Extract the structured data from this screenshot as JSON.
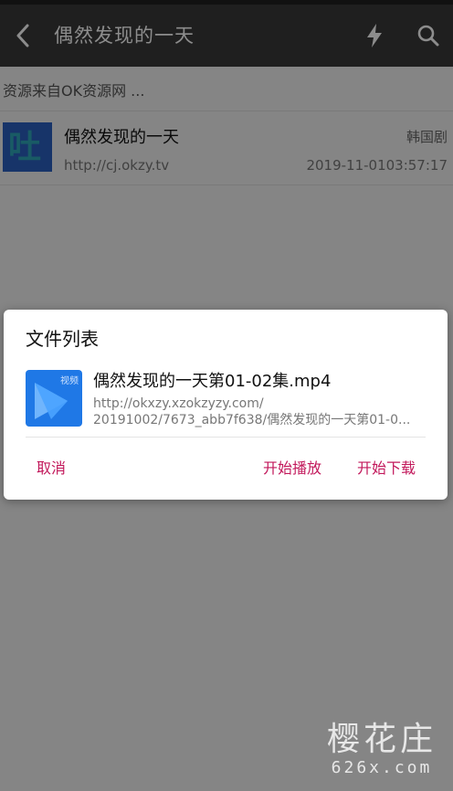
{
  "app_bar": {
    "title": "偶然发现的一天",
    "back_icon": "chevron-left-icon",
    "bolt_icon": "lightning-bolt-icon",
    "search_icon": "search-icon",
    "background": "#3a3a3a"
  },
  "source_note": "资源来自OK资源网 ...",
  "result": {
    "title": "偶然发现的一天",
    "tag": "韩国剧",
    "url": "http://cj.okzy.tv",
    "date": "2019-11-0103:57:17",
    "thumbnail_glyph": "吐"
  },
  "dialog": {
    "title": "文件列表",
    "file": {
      "name": "偶然发现的一天第01-02集.mp4",
      "icon_label": "视频",
      "url_line1": "http://okxzy.xzokzyzy.com/",
      "url_line2": "20191002/7673_abb7f638/偶然发现的一天第01-0..."
    },
    "buttons": {
      "cancel": "取消",
      "play": "开始播放",
      "download": "开始下载"
    },
    "accent_color": "#c2185b"
  },
  "watermark": {
    "line1": "樱花庄",
    "line2": "626x.com"
  }
}
